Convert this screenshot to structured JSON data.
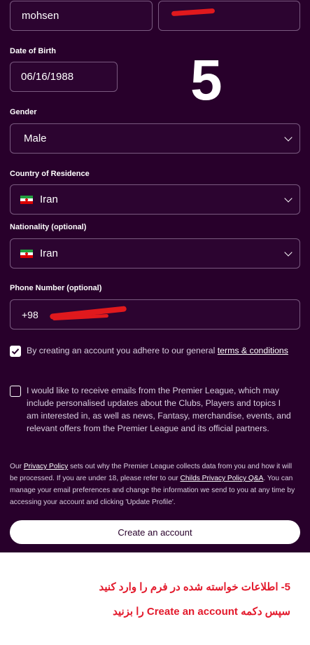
{
  "form": {
    "first_name": "mohsen",
    "dob_label": "Date of Birth",
    "dob_value": "06/16/1988",
    "gender_label": "Gender",
    "gender_value": "Male",
    "country_label": "Country of Residence",
    "country_value": "Iran",
    "nationality_label": "Nationality (optional)",
    "nationality_value": "Iran",
    "phone_label": "Phone Number (optional)",
    "phone_prefix": "+98"
  },
  "consent": {
    "terms_text": "By creating an account you adhere to our general",
    "terms_link": "terms & conditions",
    "terms_checked": true,
    "emails_text": "I would like to receive emails from the Premier League, which may include personalised updates about the Clubs, Players and topics I am interested in, as well as news, Fantasy, merchandise, events, and relevant offers from the Premier League and its official partners.",
    "emails_checked": false
  },
  "policy": {
    "prefix": "Our",
    "privacy_link": "Privacy Policy",
    "middle": "sets out why the Premier League collects data from you and how it will be processed. If you are under 18, please refer to our",
    "childs_link": "Childs Privacy Policy Q&A",
    "suffix": ". You can manage your email preferences and change the information we send to you at any time by accessing your account and clicking 'Update Profile'."
  },
  "create_button": "Create an account",
  "annotation": {
    "step_number": "5",
    "line1": "5- اطلاعات خواسته شده در فرم را وارد کنید",
    "line2": "سپس دکمه Create an account را بزنید"
  },
  "icons": [
    "iran-flag-icon",
    "chevron-down-icon",
    "checkmark-icon"
  ],
  "colors": {
    "background": "#28002b",
    "annotation_red": "#e3192b"
  }
}
